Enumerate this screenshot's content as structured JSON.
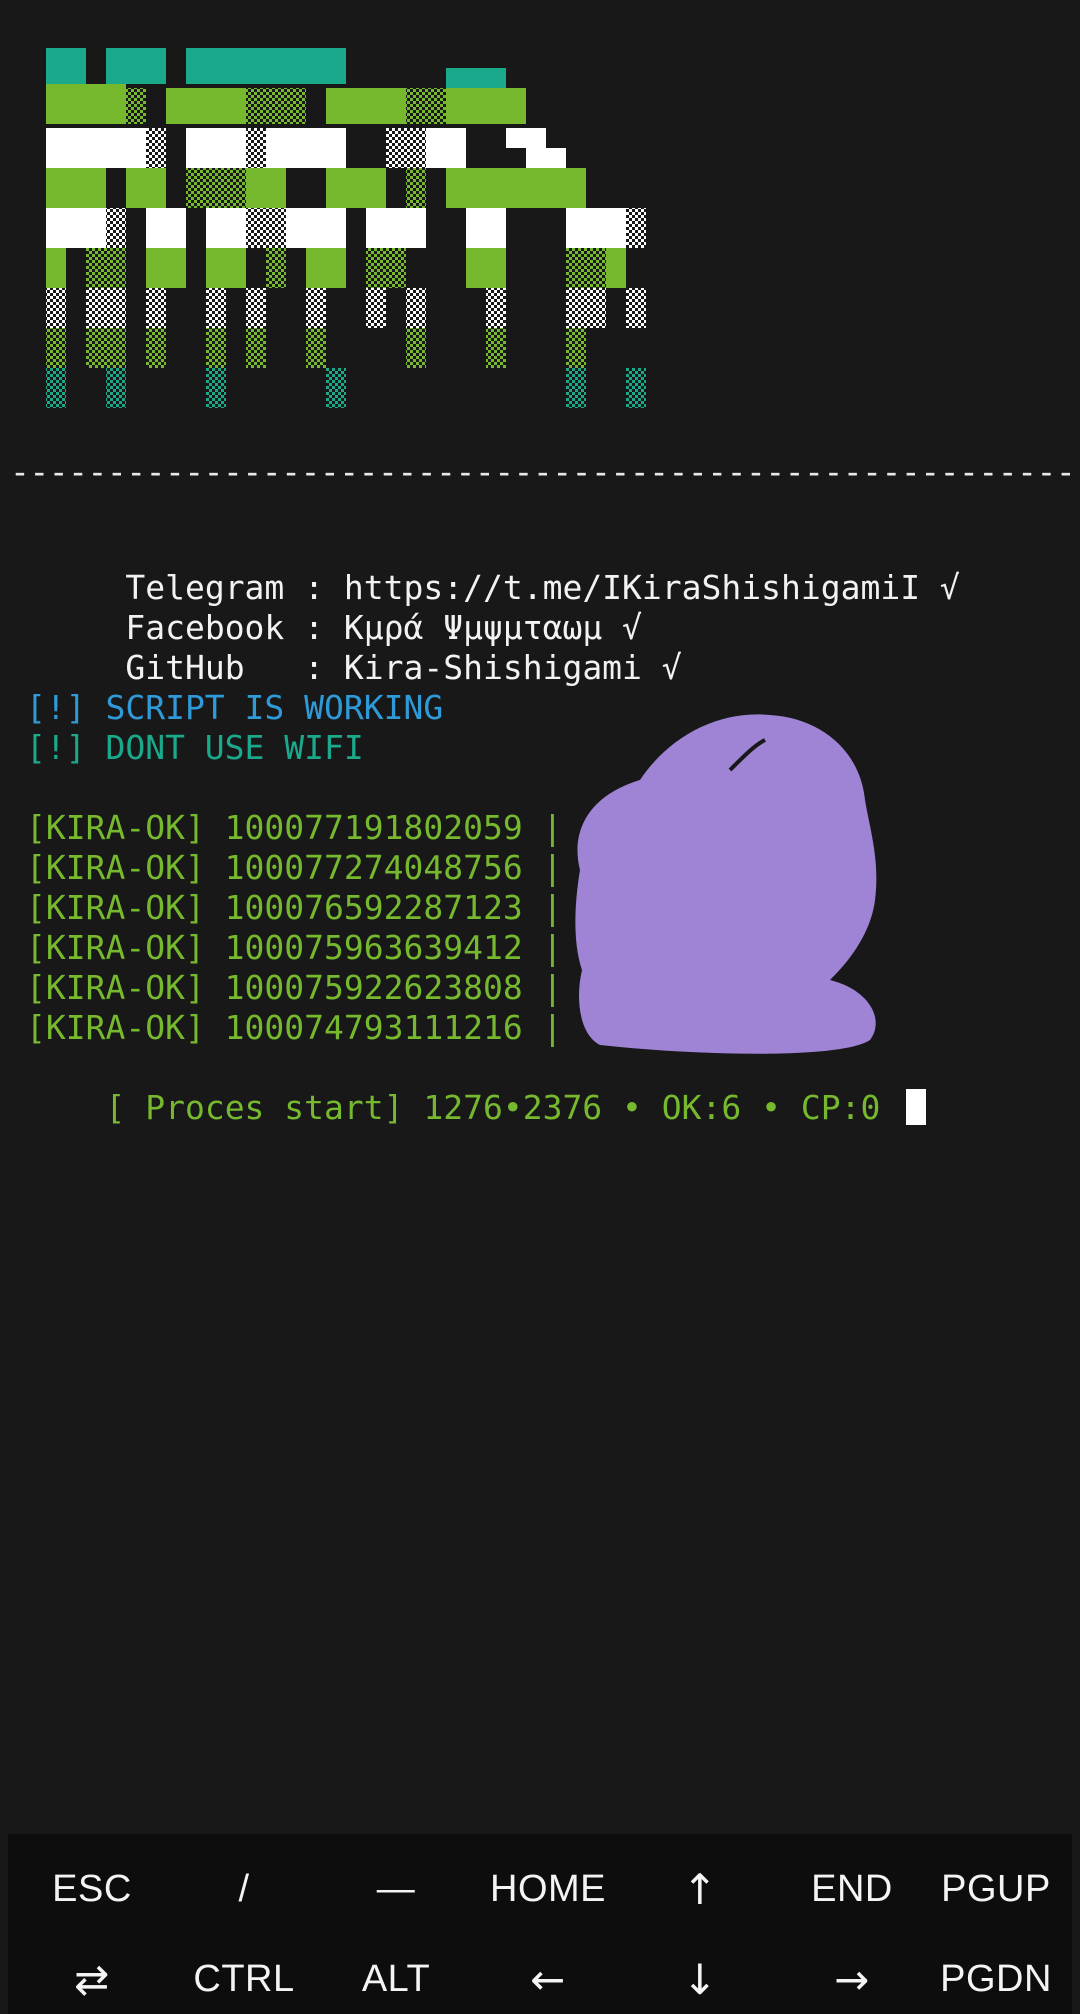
{
  "terminal": {
    "divider": "-------------------------------------------------------",
    "info_lines": [
      {
        "label": " Telegram : ",
        "value": "https://t.me/IKiraShishigamiI √"
      },
      {
        "label": " Facebook : ",
        "value": "Κμρά Ψμψμταωμ √"
      },
      {
        "label": " GitHub   : ",
        "value": "Kira-Shishigami √"
      }
    ],
    "status": [
      {
        "text": "[!] SCRIPT IS WORKING",
        "color": "#2f9ad8"
      },
      {
        "text": "[!] DONT USE WIFI",
        "color": "#1aa98a"
      }
    ],
    "ok_entries": [
      "[KIRA-OK] 100077191802059 | c",
      "[KIRA-OK] 100077274048756 |",
      "[KIRA-OK] 100076592287123 |",
      "[KIRA-OK] 100075963639412 |",
      "[KIRA-OK] 100075922623808 |",
      "[KIRA-OK] 100074793111216 |"
    ],
    "progress": "[ Proces start] 1276•2376 • OK:6 • CP:0",
    "colors": {
      "background": "#181818",
      "text": "#f2f2f2",
      "green": "#76b82e",
      "teal": "#1aa98a",
      "blue": "#2f9ad8",
      "redaction": "#9f84d6"
    }
  },
  "extra_keys": {
    "row1": [
      "ESC",
      "/",
      "—",
      "HOME",
      "↑",
      "END",
      "PGUP"
    ],
    "row2": [
      "⇄",
      "CTRL",
      "ALT",
      "←",
      "↓",
      "→",
      "PGDN"
    ]
  }
}
